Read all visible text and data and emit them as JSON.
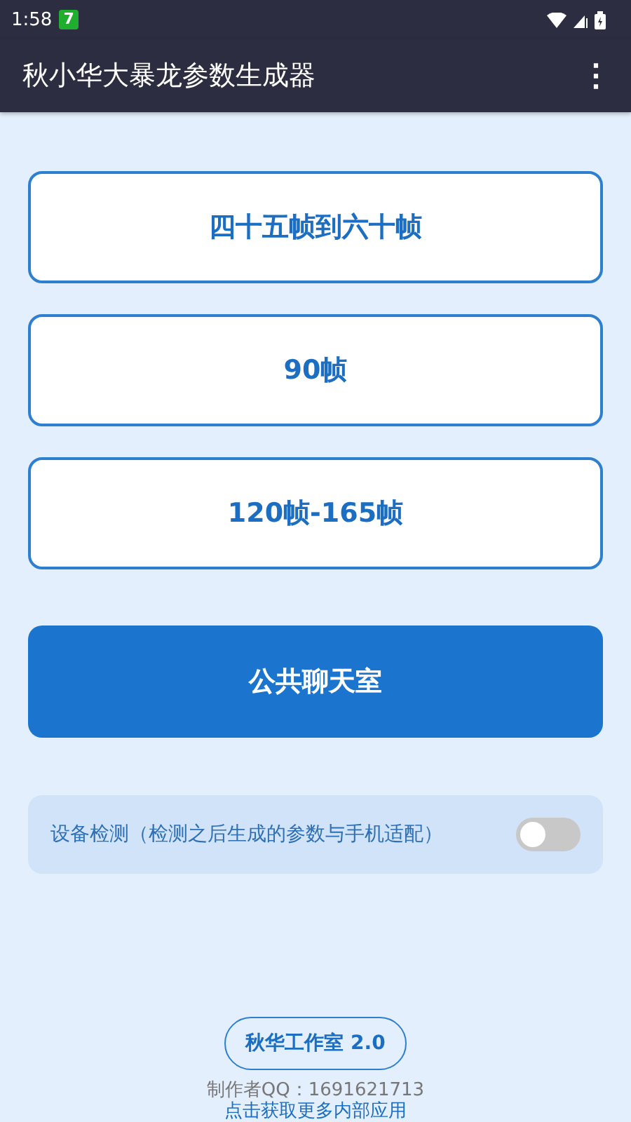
{
  "status_bar": {
    "time": "1:58",
    "badge": "7"
  },
  "app_bar": {
    "title": "秋小华大暴龙参数生成器",
    "menu": "⋮"
  },
  "buttons": [
    {
      "label": "四十五帧到六十帧",
      "kind": "outline"
    },
    {
      "label": "90帧",
      "kind": "outline"
    },
    {
      "label": "120帧-165帧",
      "kind": "outline"
    },
    {
      "label": "公共聊天室",
      "kind": "filled"
    }
  ],
  "device_check": {
    "label": "设备检测（检测之后生成的参数与手机适配）",
    "on": false
  },
  "footer": {
    "studio": "秋华工作室 2.0",
    "author": "制作者QQ：1691621713",
    "link": "点击获取更多内部应用"
  }
}
